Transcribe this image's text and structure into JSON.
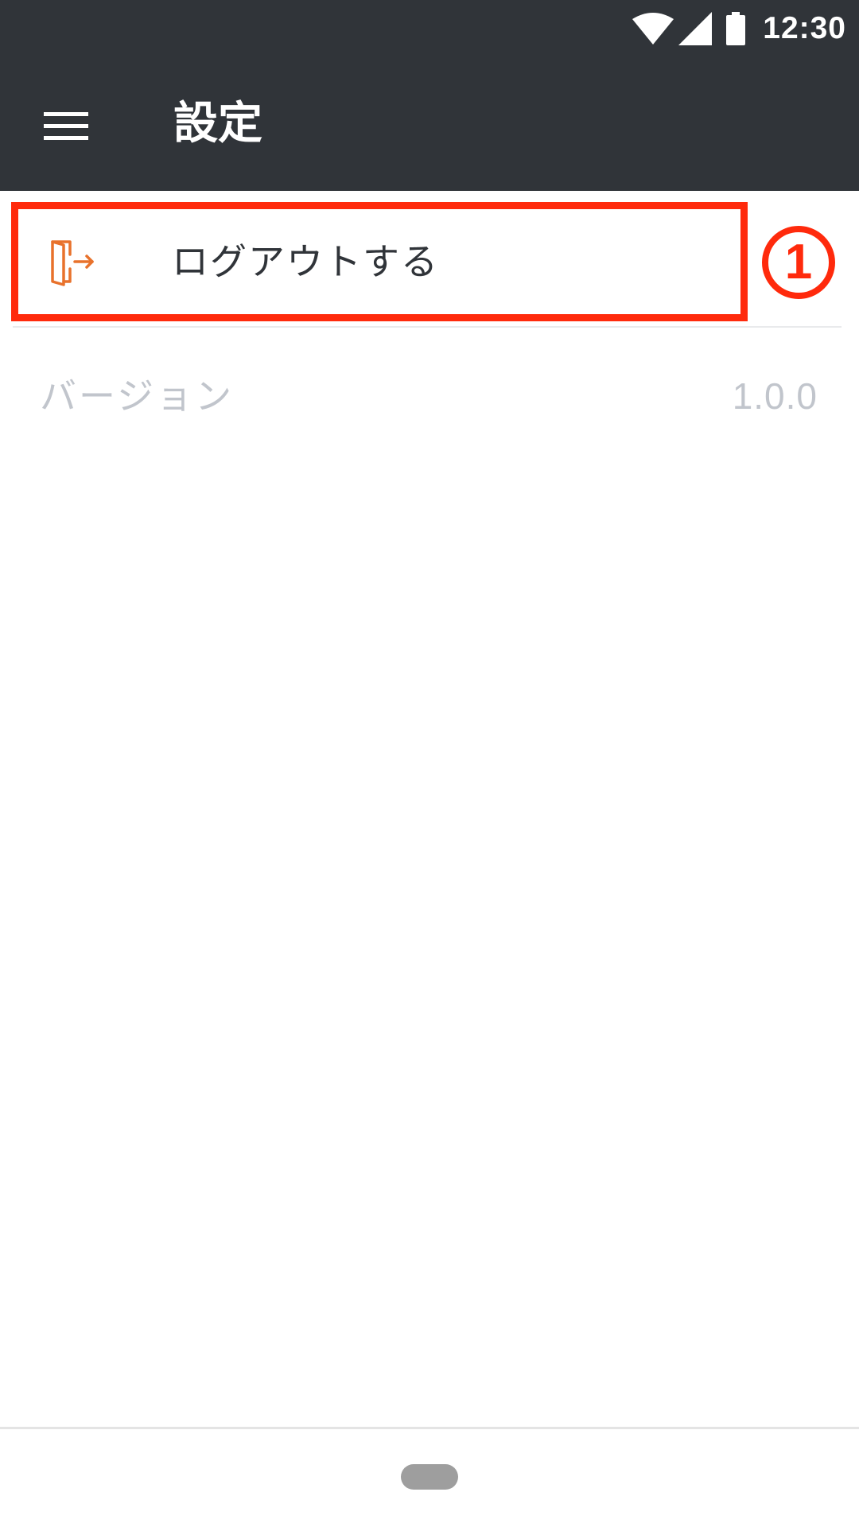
{
  "status_bar": {
    "time": "12:30",
    "icons": [
      "wifi-icon",
      "signal-icon",
      "battery-icon"
    ]
  },
  "toolbar": {
    "menu_icon": "hamburger-menu-icon",
    "title": "設定"
  },
  "settings": {
    "logout": {
      "icon": "logout-door-icon",
      "label": "ログアウトする"
    },
    "version": {
      "label": "バージョン",
      "value": "1.0.0"
    }
  },
  "annotation": {
    "step_marker": "1"
  },
  "colors": {
    "toolbar_bg": "#303439",
    "accent_orange": "#e8722c",
    "highlight_red": "#ff2a0c",
    "muted_text": "#c1c5cc"
  }
}
